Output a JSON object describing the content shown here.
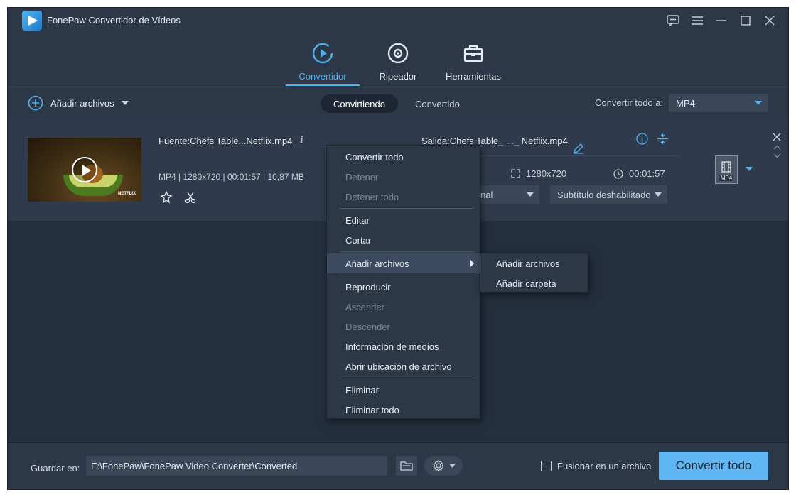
{
  "app": {
    "title": "FonePaw Convertidor de Vídeos"
  },
  "nav": {
    "tabs": [
      {
        "label": "Convertidor",
        "icon": "convert-icon",
        "active": true
      },
      {
        "label": "Ripeador",
        "icon": "disc-icon",
        "active": false
      },
      {
        "label": "Herramientas",
        "icon": "toolbox-icon",
        "active": false
      }
    ]
  },
  "toolbar": {
    "add_files": "Añadir archivos",
    "segments": [
      "Convirtiendo",
      "Convertido"
    ],
    "convert_all_to_label": "Convertir todo a:",
    "format_value": "MP4"
  },
  "file": {
    "source_name": "Fuente:Chefs Table...Netflix.mp4",
    "source_meta": "MP4 | 1280x720 | 00:01:57 | 10,87 MB",
    "output_name": "Salida:Chefs Table_ ..._ Netflix.mp4",
    "output_resolution": "1280x720",
    "output_duration": "00:01:57",
    "audio_value": "nal",
    "subtitle_value": "Subtítulo deshabilitado",
    "thumbnail_watermark": "NETFLIX",
    "format_badge": "MP4"
  },
  "context_menu": {
    "items": [
      {
        "label": "Convertir todo",
        "disabled": false
      },
      {
        "label": "Detener",
        "disabled": true
      },
      {
        "label": "Detener todo",
        "disabled": true
      },
      {
        "label": "Editar",
        "disabled": false
      },
      {
        "label": "Cortar",
        "disabled": false
      },
      {
        "label": "Añadir archivos",
        "disabled": false,
        "submenu": true
      },
      {
        "label": "Reproducir",
        "disabled": false
      },
      {
        "label": "Ascender",
        "disabled": true
      },
      {
        "label": "Descender",
        "disabled": true
      },
      {
        "label": "Información de medios",
        "disabled": false
      },
      {
        "label": "Abrir ubicación de archivo",
        "disabled": false
      },
      {
        "label": "Eliminar",
        "disabled": false
      },
      {
        "label": "Eliminar todo",
        "disabled": false
      }
    ],
    "submenu": [
      "Añadir archivos",
      "Añadir carpeta"
    ]
  },
  "footer": {
    "save_label": "Guardar en:",
    "path": "E:\\FonePaw\\FonePaw Video Converter\\Converted",
    "merge_label": "Fusionar en un archivo",
    "convert_button": "Convertir todo"
  },
  "colors": {
    "accent": "#4fb2ef",
    "button": "#5fb6f2",
    "background": "#242f3d"
  }
}
